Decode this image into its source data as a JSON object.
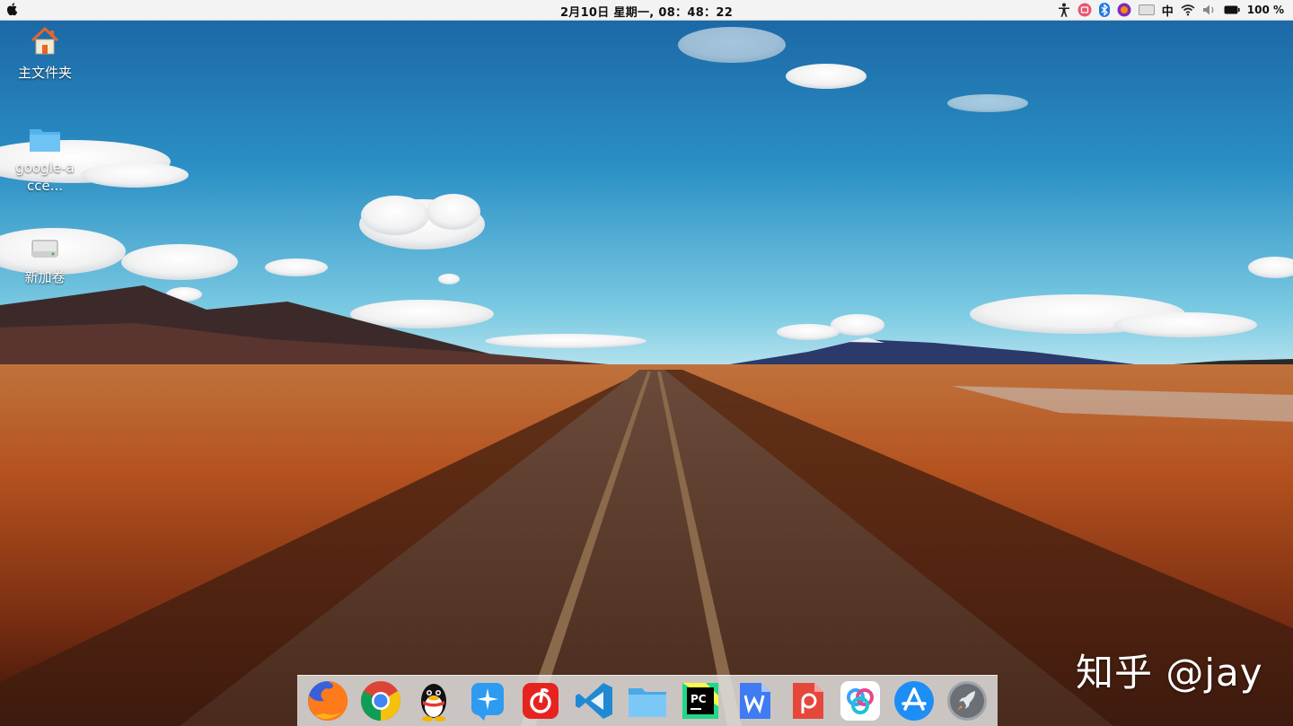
{
  "menubar": {
    "clock": "2月10日 星期一, 08：48：22",
    "ime": "中",
    "battery": "100 %",
    "tray_icons": [
      "accessibility-icon",
      "screen-recorder-icon",
      "bluetooth-icon",
      "firefox-tray-icon",
      "keyboard-layout-icon",
      "input-method",
      "wifi-icon",
      "volume-icon",
      "battery-icon"
    ]
  },
  "desktop": {
    "icons": [
      {
        "label": "主文件夹",
        "icon": "home-folder-icon"
      },
      {
        "label": "google-acce...",
        "icon": "folder-icon"
      },
      {
        "label": "新加卷",
        "icon": "drive-icon"
      }
    ]
  },
  "dock": {
    "apps": [
      {
        "name": "Firefox",
        "icon": "firefox-icon"
      },
      {
        "name": "Chrome",
        "icon": "chrome-icon"
      },
      {
        "name": "QQ",
        "icon": "qq-icon"
      },
      {
        "name": "Lark",
        "icon": "lark-icon"
      },
      {
        "name": "NetEase Cloud Music",
        "icon": "netease-music-icon"
      },
      {
        "name": "VS Code",
        "icon": "vscode-icon"
      },
      {
        "name": "Files",
        "icon": "files-icon"
      },
      {
        "name": "PyCharm",
        "icon": "pycharm-icon"
      },
      {
        "name": "WPS Writer",
        "icon": "wps-writer-icon"
      },
      {
        "name": "WPS Presentation",
        "icon": "wps-presentation-icon"
      },
      {
        "name": "Baidu Netdisk",
        "icon": "baidu-netdisk-icon"
      },
      {
        "name": "App Store",
        "icon": "app-store-icon"
      },
      {
        "name": "Launchpad",
        "icon": "launchpad-icon"
      }
    ]
  },
  "watermark": "知乎 @jay",
  "colors": {
    "sky_top": "#1e6fae",
    "sky_horizon": "#8fd0e6",
    "ground": "#b4501f",
    "menubar": "#f3f3f3",
    "dock": "#e6e6e6"
  }
}
